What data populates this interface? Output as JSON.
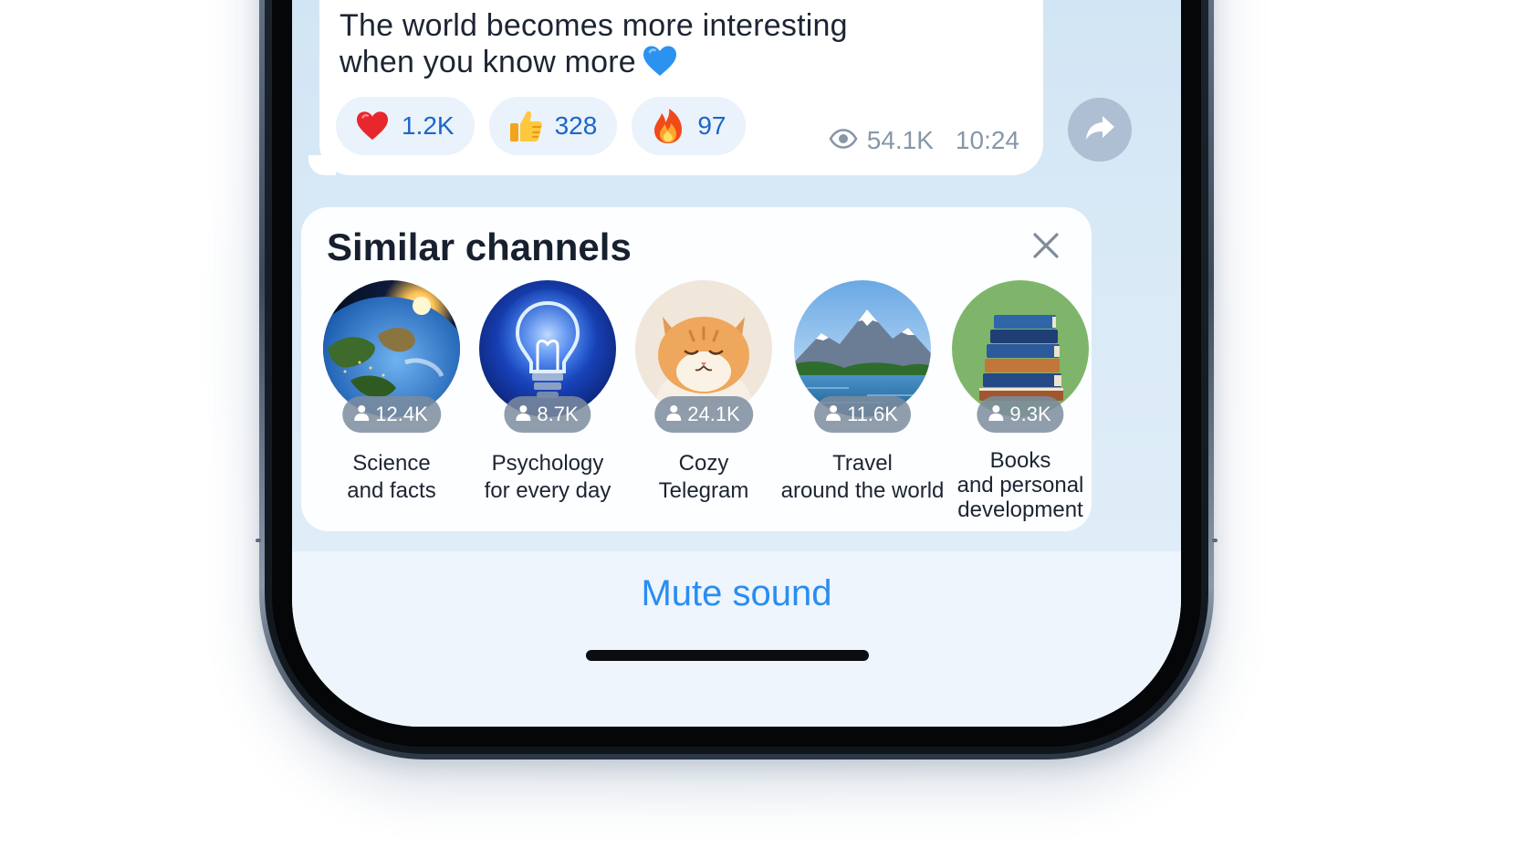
{
  "message": {
    "text_line1": "The world becomes more interesting",
    "text_line2": "when you know more",
    "text_emoji": "blue-heart",
    "reactions": [
      {
        "emoji": "red-heart",
        "count": "1.2K"
      },
      {
        "emoji": "thumbs-up",
        "count": "328"
      },
      {
        "emoji": "fire",
        "count": "97"
      }
    ],
    "views": "54.1K",
    "time": "10:24"
  },
  "similar_channels": {
    "title": "Similar channels",
    "channels": [
      {
        "name_line1": "Science",
        "name_line2": "and facts",
        "name_line3": "",
        "subscribers": "12.4K",
        "avatar": "earth-from-space"
      },
      {
        "name_line1": "Psychology",
        "name_line2": "for every day",
        "name_line3": "",
        "subscribers": "8.7K",
        "avatar": "light-bulb"
      },
      {
        "name_line1": "Cozy",
        "name_line2": "Telegram",
        "name_line3": "",
        "subscribers": "24.1K",
        "avatar": "smiling-cat"
      },
      {
        "name_line1": "Travel",
        "name_line2": "around the world",
        "name_line3": "",
        "subscribers": "11.6K",
        "avatar": "mountain-lake"
      },
      {
        "name_line1": "Books",
        "name_line2": "and personal",
        "name_line3": "development",
        "subscribers": "9.3K",
        "avatar": "stack-of-books"
      }
    ]
  },
  "bottom": {
    "mute_label": "Mute sound"
  },
  "colors": {
    "accent": "#2a8df0",
    "reaction_count": "#1c66c9",
    "meta": "#8797a8"
  }
}
